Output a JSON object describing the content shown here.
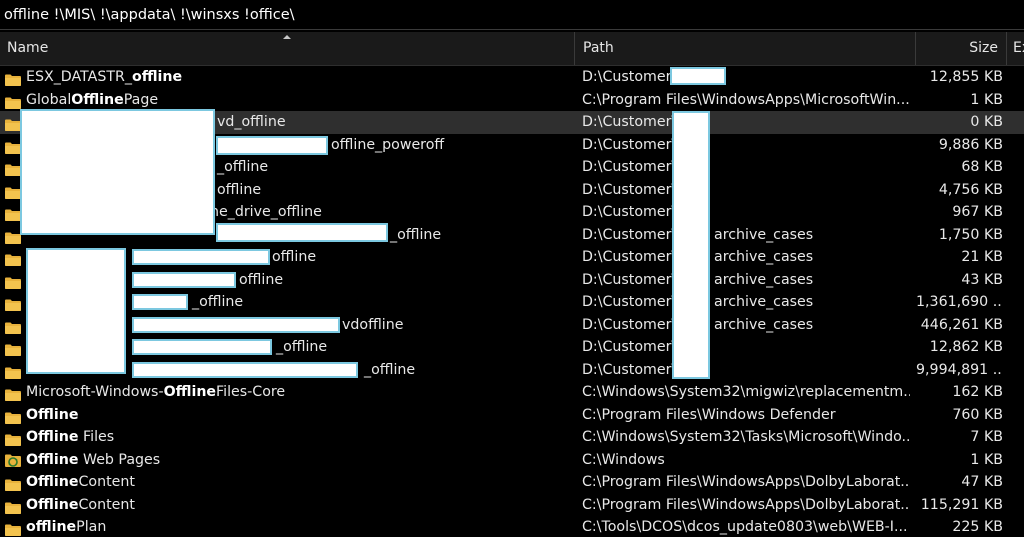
{
  "search": {
    "query": "offline !\\MIS\\ !\\appdata\\ !\\winsxs !office\\"
  },
  "columns": {
    "name": "Name",
    "path": "Path",
    "size": "Size",
    "ext": "Ex"
  },
  "colors": {
    "folder": "#e8b23c",
    "selected_row": "#2f2f2f",
    "redaction_border": "#7cc8e0"
  },
  "rows": [
    {
      "pre": "ESX_DATASTR_",
      "bold": "offline",
      "post": "",
      "path": "D:\\Customer\\",
      "size": "12,855 KB",
      "icon": "folder-icon"
    },
    {
      "pre": "Global",
      "bold": "Offline",
      "post": "Page",
      "path": "C:\\Program Files\\WindowsApps\\MicrosoftWin...",
      "size": "1 KB",
      "icon": "folder-icon"
    },
    {
      "pre": "",
      "bold": "",
      "post": "vd_offline",
      "path": "D:\\Customer\\",
      "size": "0 KB",
      "icon": "folder-icon",
      "selected": true
    },
    {
      "pre": "",
      "bold": "",
      "post": "offline_poweroff",
      "path": "D:\\Customer\\",
      "size": "9,886 KB",
      "icon": "folder-icon"
    },
    {
      "pre": "",
      "bold": "",
      "post": "_offline",
      "path": "D:\\Customer\\",
      "size": "68 KB",
      "icon": "folder-icon"
    },
    {
      "pre": "",
      "bold": "",
      "post": "offline",
      "path": "D:\\Customer\\",
      "size": "4,756 KB",
      "icon": "folder-icon"
    },
    {
      "pre": "",
      "bold": "",
      "post": "ne_drive_offline",
      "path": "D:\\Customer\\",
      "size": "967 KB",
      "icon": "folder-icon"
    },
    {
      "pre": "",
      "bold": "",
      "post": "_offline",
      "path": "D:\\Customer\\",
      "path_post": "archive_cases",
      "size": "1,750 KB",
      "icon": "folder-icon"
    },
    {
      "pre": "",
      "bold": "",
      "post": "offline",
      "path": "D:\\Customer\\",
      "path_post": "archive_cases",
      "size": "21 KB",
      "icon": "folder-icon"
    },
    {
      "pre": "",
      "bold": "",
      "post": "offline",
      "path": "D:\\Customer\\",
      "path_post": "archive_cases",
      "size": "43 KB",
      "icon": "folder-icon"
    },
    {
      "pre": "",
      "bold": "",
      "post": "_offline",
      "path": "D:\\Customer\\",
      "path_post": "archive_cases",
      "size": "1,361,690 ...",
      "icon": "folder-icon"
    },
    {
      "pre": "",
      "bold": "",
      "post": "vdoffline",
      "path": "D:\\Customer\\",
      "path_post": "archive_cases",
      "size": "446,261 KB",
      "icon": "folder-icon"
    },
    {
      "pre": "",
      "bold": "",
      "post": "_offline",
      "path": "D:\\Customer\\",
      "size": "12,862 KB",
      "icon": "folder-icon"
    },
    {
      "pre": "",
      "bold": "",
      "post": "_offline",
      "path": "D:\\Customer\\",
      "size": "9,994,891 ...",
      "icon": "folder-icon"
    },
    {
      "pre": "Microsoft-Windows-",
      "bold": "Offline",
      "post": "Files-Core",
      "path": "C:\\Windows\\System32\\migwiz\\replacementm...",
      "size": "162 KB",
      "icon": "folder-icon"
    },
    {
      "pre": "",
      "bold": "Offline",
      "post": "",
      "path": "C:\\Program Files\\Windows Defender",
      "size": "760 KB",
      "icon": "folder-icon"
    },
    {
      "pre": "",
      "bold": "Offline",
      "post": " Files",
      "path": "C:\\Windows\\System32\\Tasks\\Microsoft\\Windo...",
      "size": "7 KB",
      "icon": "folder-icon"
    },
    {
      "pre": "",
      "bold": "Offline",
      "post": " Web Pages",
      "path": "C:\\Windows",
      "size": "1 KB",
      "icon": "offline-web-pages-icon"
    },
    {
      "pre": "",
      "bold": "Offline",
      "post": "Content",
      "path": "C:\\Program Files\\WindowsApps\\DolbyLaborat...",
      "size": "47 KB",
      "icon": "folder-icon"
    },
    {
      "pre": "",
      "bold": "Offline",
      "post": "Content",
      "path": "C:\\Program Files\\WindowsApps\\DolbyLaborat...",
      "size": "115,291 KB",
      "icon": "folder-icon"
    },
    {
      "pre": "",
      "bold": "offline",
      "post": "Plan",
      "path": "C:\\Tools\\DCOS\\dcos_update0803\\web\\WEB-I...",
      "size": "225 KB",
      "icon": "folder-icon"
    }
  ]
}
